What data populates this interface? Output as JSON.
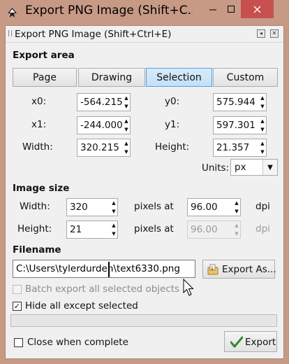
{
  "window": {
    "title": "Export PNG Image (Shift+C...",
    "minimize_icon": "minimize-icon",
    "maximize_icon": "maximize-icon",
    "close_icon": "close-icon",
    "close_color": "#c7504f"
  },
  "dock": {
    "title": "Export PNG Image (Shift+Ctrl+E)",
    "iconify_glyph": "◂",
    "close_glyph": "✕"
  },
  "export_area": {
    "heading": "Export area",
    "tabs": [
      {
        "label": "Page",
        "active": false
      },
      {
        "label": "Drawing",
        "active": false
      },
      {
        "label": "Selection",
        "active": true
      },
      {
        "label": "Custom",
        "active": false
      }
    ],
    "x0": {
      "label": "x0:",
      "value": "-564.215"
    },
    "y0": {
      "label": "y0:",
      "value": "575.944"
    },
    "x1": {
      "label": "x1:",
      "value": "-244.000"
    },
    "y1": {
      "label": "y1:",
      "value": "597.301"
    },
    "width": {
      "label": "Width:",
      "value": "320.215"
    },
    "height": {
      "label": "Height:",
      "value": "21.357"
    },
    "units": {
      "label": "Units:",
      "value": "px"
    }
  },
  "image_size": {
    "heading": "Image size",
    "width": {
      "label": "Width:",
      "value": "320",
      "at_label": "pixels at",
      "dpi": "96.00",
      "dpi_label": "dpi"
    },
    "height": {
      "label": "Height:",
      "value": "21",
      "at_label": "pixels at",
      "dpi": "96.00",
      "dpi_label": "dpi"
    }
  },
  "filename": {
    "heading": "Filename",
    "value": "C:\\Users\\tylerdurden\\text6330.png",
    "export_as_label": "Export As..."
  },
  "options": {
    "batch_export_label": "Batch export all selected objects",
    "batch_export_checked": false,
    "batch_export_enabled": false,
    "hide_all_label": "Hide all except selected",
    "hide_all_checked": true,
    "close_when_complete_label": "Close when complete",
    "close_when_complete_checked": false
  },
  "export_button_label": "Export",
  "accent_color": "#c2e0f7"
}
